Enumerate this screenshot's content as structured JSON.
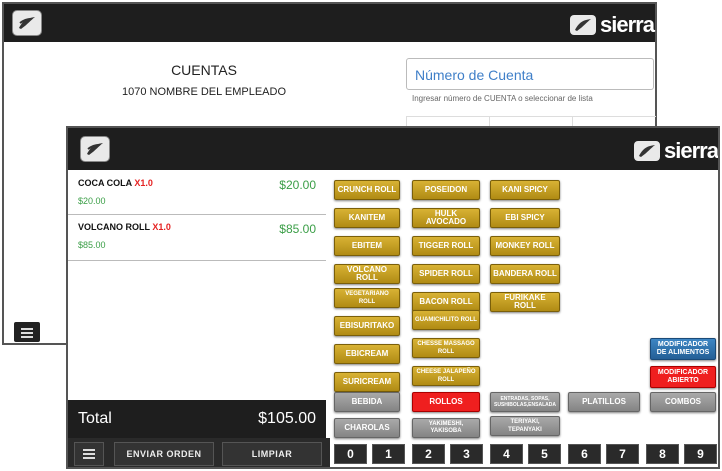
{
  "back_window": {
    "cuentas_title": "CUENTAS",
    "employee": "1070 NOMBRE DEL EMPLEADO",
    "account_input": {
      "value": "Número de Cuenta"
    },
    "account_help": "Ingresar número de CUENTA o seleccionar de lista",
    "brand": "sierra"
  },
  "front_window": {
    "brand": "sierra",
    "order_items": [
      {
        "name": "COCA COLA",
        "qty": "X1.0",
        "subtotal": "$20.00",
        "price": "$20.00"
      },
      {
        "name": "VOLCANO ROLL",
        "qty": "X1.0",
        "subtotal": "$85.00",
        "price": "$85.00"
      }
    ],
    "total_label": "Total",
    "total_amount": "$105.00",
    "bottom": {
      "enviar": "ENVIAR ORDEN",
      "limpiar": "LIMPIAR"
    },
    "products": {
      "col1": [
        "CRUNCH ROLL",
        "KANITEM",
        "EBITEM",
        "VOLCANO ROLL",
        "VEGETARIANO ROLL",
        "EBISURITAKO",
        "EBICREAM",
        "SURICREAM"
      ],
      "col2": [
        "POSEIDON",
        "HULK AVOCADO",
        "TIGGER ROLL",
        "SPIDER ROLL",
        "BACON ROLL",
        "GUAMICHILITO ROLL",
        "CHESSE MASSAGO ROLL",
        "CHEESE JALAPEÑO ROLL"
      ],
      "col3": [
        "KANI SPICY",
        "EBI SPICY",
        "MONKEY ROLL",
        "BANDERA ROLL",
        "FURIKAKE ROLL"
      ]
    },
    "modifiers": {
      "alimentos": "MODIFICADOR DE ALIMENTOS",
      "abierto": "MODIFICADOR ABIERTO"
    },
    "categories": {
      "bebida": "BEBIDA",
      "rollos": "ROLLOS",
      "entradas": "ENTRADAS, SOPAS, SUSHIBOLAS,ENSALADA",
      "platillos": "PLATILLOS",
      "combos": "COMBOS",
      "charolas": "CHAROLAS",
      "yakimeshi": "YAKIMESHI, YAKISOBA",
      "teriyaki": "TERIYAKI, TEPANYAKI"
    },
    "numbers": [
      "0",
      "1",
      "2",
      "3",
      "4",
      "5",
      "6",
      "7",
      "8",
      "9"
    ]
  },
  "colors": {
    "gold": "#c9a227",
    "green": "#3a9e46",
    "red": "#ef1f1f",
    "blue": "#2d6fa8"
  }
}
